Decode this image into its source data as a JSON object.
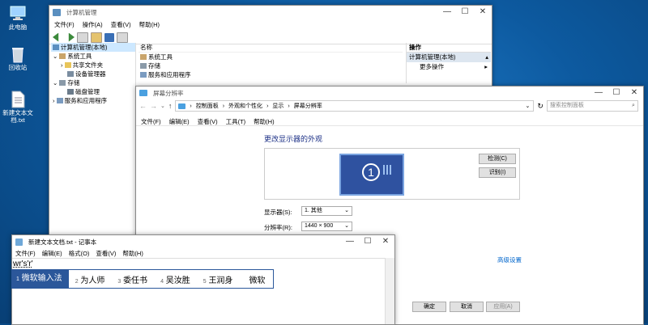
{
  "desktop": {
    "icons": [
      {
        "label": "此电脑"
      },
      {
        "label": "回收站"
      },
      {
        "label": "新建文本文档.txt"
      }
    ]
  },
  "compmgmt": {
    "title": "计算机管理",
    "menu": [
      "文件(F)",
      "操作(A)",
      "查看(V)",
      "帮助(H)"
    ],
    "tree": {
      "root": "计算机管理(本地)",
      "system_tools": "系统工具",
      "shared_folders": "共享文件夹",
      "device_manager": "设备管理器",
      "storage": "存储",
      "disk_mgmt": "磁盘管理",
      "services": "服务和应用程序"
    },
    "list_header": "名称",
    "list_items": [
      "系统工具",
      "存储",
      "服务和应用程序"
    ],
    "actions": {
      "header": "操作",
      "selected": "计算机管理(本地)",
      "more": "更多操作"
    }
  },
  "display": {
    "title": "屏幕分辨率",
    "breadcrumb": [
      "控制面板",
      "外观和个性化",
      "显示",
      "屏幕分辨率"
    ],
    "search_placeholder": "搜索控制面板",
    "menu": [
      "文件(F)",
      "编辑(E)",
      "查看(V)",
      "工具(T)",
      "帮助(H)"
    ],
    "heading": "更改显示器的外观",
    "monitor_number": "1",
    "detect": "检测(C)",
    "identify": "识别(I)",
    "display_label": "显示器(S):",
    "display_value": "1. 其他",
    "resolution_label": "分辨率(R):",
    "resolution_value": "1440 × 900",
    "advanced": "高级设置",
    "ok": "确定",
    "cancel": "取消",
    "apply": "应用(A)"
  },
  "notepad": {
    "title": "新建文本文档.txt - 记事本",
    "menu": [
      "文件(F)",
      "编辑(E)",
      "格式(O)",
      "查看(V)",
      "帮助(H)"
    ],
    "text": "wr's'r'"
  },
  "ime": {
    "candidates": [
      {
        "num": "1",
        "text": "微软输入法"
      },
      {
        "num": "2",
        "text": "为人师"
      },
      {
        "num": "3",
        "text": "委任书"
      },
      {
        "num": "4",
        "text": "吴汝胜"
      },
      {
        "num": "5",
        "text": "王润身"
      }
    ],
    "tail": "微软"
  }
}
